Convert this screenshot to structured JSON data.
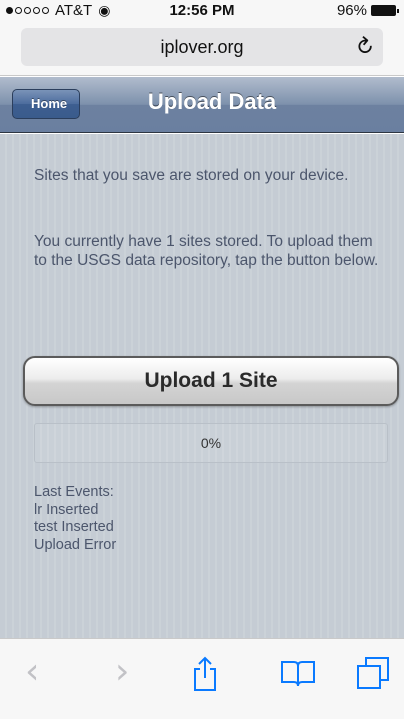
{
  "status_bar": {
    "carrier": "AT&T",
    "time": "12:56 PM",
    "battery": "96%"
  },
  "browser": {
    "url": "iplover.org"
  },
  "header": {
    "back_label": "Home",
    "title": "Upload Data"
  },
  "main": {
    "paragraph1": "Sites that you save are stored on your device.",
    "paragraph2": "You currently have 1 sites stored. To upload them to the USGS data repository, tap the button below.",
    "upload_button_label": "Upload 1 Site",
    "progress_text": "0%",
    "progress_value": 0,
    "events": [
      "Last Events:",
      "lr Inserted",
      "test Inserted",
      "Upload Error"
    ]
  },
  "icons": {
    "back": "chevron-left-icon",
    "forward": "chevron-right-icon",
    "share": "share-icon",
    "bookmarks": "book-icon",
    "tabs": "tabs-icon",
    "reload": "reload-icon"
  },
  "colors": {
    "header_blue": "#6d81a0",
    "ios_blue": "#0a7aff"
  }
}
